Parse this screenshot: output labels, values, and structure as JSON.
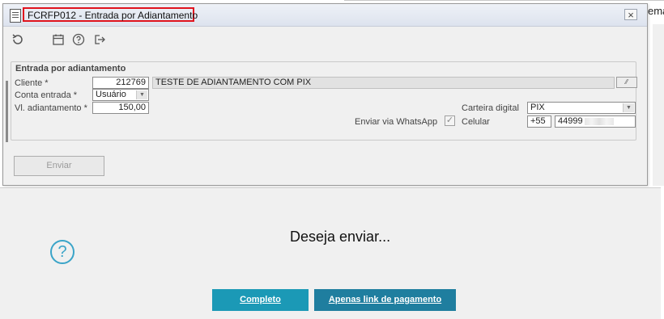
{
  "background": {
    "partial_text": "ema"
  },
  "window": {
    "title": "FCRFP012 - Entrada por Adiantamento",
    "close_glyph": "×"
  },
  "toolbar": {
    "icons": [
      "refresh-icon",
      "calendar-icon",
      "help-icon",
      "exit-icon"
    ]
  },
  "form": {
    "group_title": "Entrada por adiantamento",
    "cliente": {
      "label": "Cliente *",
      "code": "212769",
      "name": "TESTE DE ADIANTAMENTO COM PIX"
    },
    "conta_entrada": {
      "label": "Conta entrada *",
      "value": "Usuário"
    },
    "vl_adiantamento": {
      "label": "Vl. adiantamento *",
      "value": "150,00"
    },
    "carteira_digital": {
      "label": "Carteira digital",
      "value": "PIX"
    },
    "enviar_whatsapp": {
      "label": "Enviar via WhatsApp",
      "checked": true
    },
    "celular": {
      "label": "Celular",
      "ddi": "+55",
      "number_visible": "44999"
    },
    "enviar_label": "Enviar"
  },
  "dialog": {
    "message": "Deseja enviar...",
    "icon": "question-icon",
    "buttons": {
      "completo": "Completo",
      "link": "Apenas link de pagamento"
    }
  },
  "colors": {
    "title_highlight": "#e0141e",
    "accent_button_1": "#1b99b6",
    "accent_button_2": "#1f7e9f",
    "question_icon": "#3aa4c8"
  }
}
